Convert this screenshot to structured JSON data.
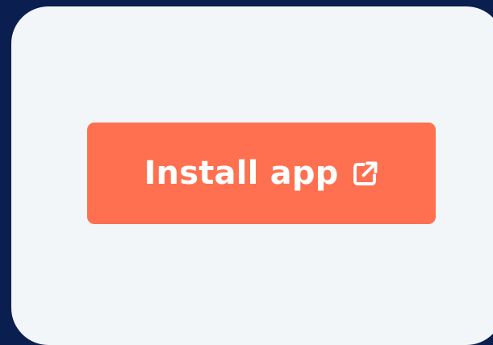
{
  "button": {
    "label": "Install app",
    "icon": "external-link-icon",
    "color": "#ff7050",
    "text_color": "#ffffff"
  },
  "card": {
    "background": "#f3f6f9"
  },
  "page": {
    "background": "#0a1f4f"
  }
}
